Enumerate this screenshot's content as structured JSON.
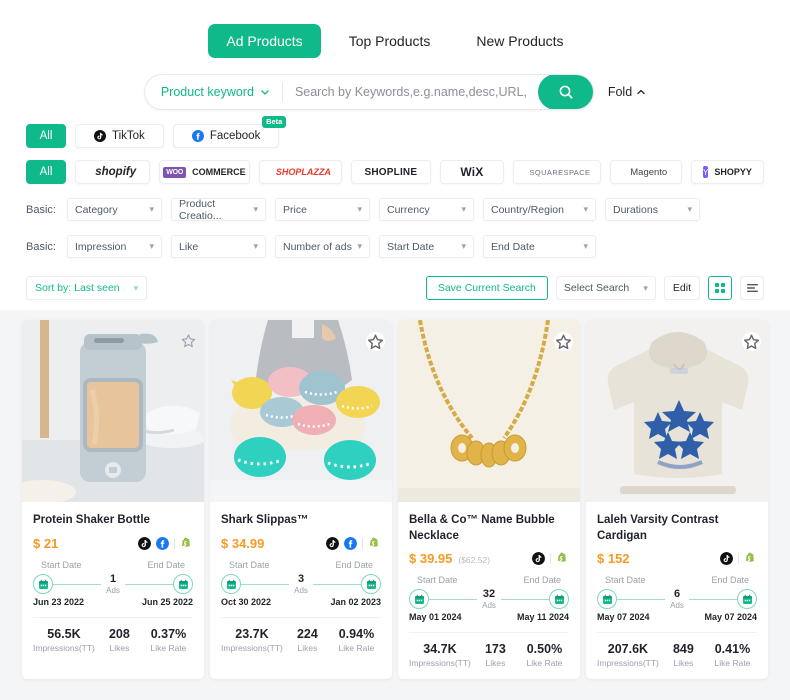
{
  "colors": {
    "accent": "#0fb98a",
    "price": "#f59a23",
    "bg": "#f4f5f7"
  },
  "tabs": [
    {
      "label": "Ad Products",
      "active": true
    },
    {
      "label": "Top Products",
      "active": false
    },
    {
      "label": "New Products",
      "active": false
    }
  ],
  "search": {
    "keyword_selector": "Product keyword",
    "placeholder": "Search by Keywords,e.g.name,desc,URL,advertiser name",
    "value": "",
    "search_icon": "search-icon",
    "fold_label": "Fold",
    "fold_icon": "chevron-up-icon"
  },
  "channel_filter": {
    "all_label": "All",
    "items": [
      {
        "label": "TikTok",
        "icon": "tiktok-icon",
        "badge": ""
      },
      {
        "label": "Facebook",
        "icon": "facebook-icon",
        "badge": "Beta"
      }
    ]
  },
  "platform_filter": {
    "all_label": "All",
    "items": [
      {
        "label": "shopify",
        "icon": "shopify-icon"
      },
      {
        "label": "COMMERCE",
        "icon": "woocommerce-icon"
      },
      {
        "label": "SHOPLAZZA",
        "icon": "shoplazza-icon"
      },
      {
        "label": "SHOPLINE",
        "icon": "shopline-icon"
      },
      {
        "label": "WiX",
        "icon": "wix-icon"
      },
      {
        "label": "SQUARESPACE",
        "icon": "squarespace-icon"
      },
      {
        "label": "Magento",
        "icon": "magento-icon"
      },
      {
        "label": "SHOPYY",
        "icon": "shopyy-icon"
      }
    ]
  },
  "filters": [
    {
      "label": "Basic:",
      "selects": [
        {
          "label": "Category"
        },
        {
          "label": "Product Creatio..."
        },
        {
          "label": "Price"
        },
        {
          "label": "Currency"
        },
        {
          "label": "Country/Region"
        },
        {
          "label": "Durations"
        }
      ]
    },
    {
      "label": "Basic:",
      "selects": [
        {
          "label": "Impression"
        },
        {
          "label": "Like"
        },
        {
          "label": "Number of ads"
        },
        {
          "label": "Start Date"
        },
        {
          "label": "End Date"
        }
      ]
    }
  ],
  "toolbar": {
    "sort_label": "Sort by: Last seen",
    "save_search_label": "Save Current Search",
    "select_search_label": "Select Search",
    "edit_label": "Edit",
    "grid_view_icon": "grid-view-icon",
    "list_view_icon": "list-view-icon"
  },
  "card_labels": {
    "start_date": "Start Date",
    "end_date": "End Date",
    "ads": "Ads",
    "impressions": "Impressions(TT)",
    "likes": "Likes",
    "like_rate": "Like Rate",
    "favorite_icon": "star-outline-icon",
    "calendar_icon": "calendar-icon"
  },
  "products": [
    {
      "title": "Protein Shaker Bottle",
      "price": "$ 21",
      "price_secondary": "",
      "channels": [
        "tiktok-icon",
        "facebook-icon",
        "shopify-icon"
      ],
      "start_date": "Jun 23 2022",
      "end_date": "Jun 25 2022",
      "ads_count": "1",
      "impressions": "56.5K",
      "likes": "208",
      "like_rate": "0.37%",
      "image": "shaker-bottle-photo"
    },
    {
      "title": "Shark Slippas™",
      "price": "$ 34.99",
      "price_secondary": "",
      "channels": [
        "tiktok-icon",
        "facebook-icon",
        "shopify-icon"
      ],
      "start_date": "Oct 30 2022",
      "end_date": "Jan 02 2023",
      "ads_count": "3",
      "impressions": "23.7K",
      "likes": "224",
      "like_rate": "0.94%",
      "image": "shark-slippers-photo"
    },
    {
      "title": "Bella & Co™ Name Bubble Necklace",
      "price": "$ 39.95",
      "price_secondary": "($62.52)",
      "channels": [
        "tiktok-icon",
        "shopify-icon"
      ],
      "start_date": "May 01 2024",
      "end_date": "May 11 2024",
      "ads_count": "32",
      "impressions": "34.7K",
      "likes": "173",
      "like_rate": "0.50%",
      "image": "olivia-necklace-photo"
    },
    {
      "title": "Laleh Varsity Contrast Cardigan",
      "price": "$ 152",
      "price_secondary": "",
      "channels": [
        "tiktok-icon",
        "shopify-icon"
      ],
      "start_date": "May 07 2024",
      "end_date": "May 07 2024",
      "ads_count": "6",
      "impressions": "207.6K",
      "likes": "849",
      "like_rate": "0.41%",
      "image": "star-hoodie-photo"
    }
  ]
}
